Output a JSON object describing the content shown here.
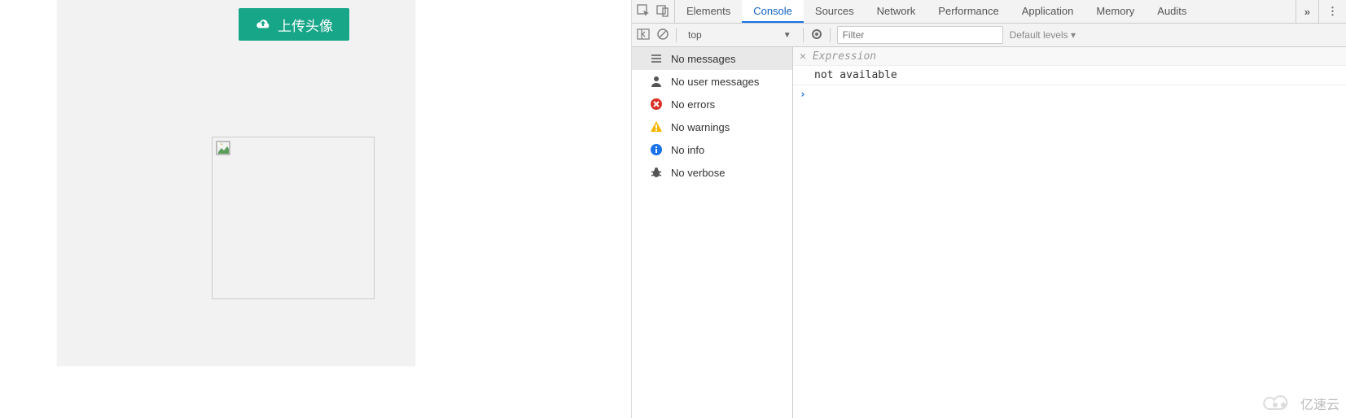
{
  "left": {
    "upload_label": "上传头像"
  },
  "devtools": {
    "tabs": [
      "Elements",
      "Console",
      "Sources",
      "Network",
      "Performance",
      "Application",
      "Memory",
      "Audits"
    ],
    "active_tab": "Console",
    "more": "»",
    "toolbar": {
      "context": "top",
      "filter_placeholder": "Filter",
      "levels": "Default levels ▾"
    },
    "sidebar": {
      "items": [
        {
          "icon": "list",
          "label": "No messages"
        },
        {
          "icon": "user",
          "label": "No user messages"
        },
        {
          "icon": "error",
          "label": "No errors"
        },
        {
          "icon": "warn",
          "label": "No warnings"
        },
        {
          "icon": "info",
          "label": "No info"
        },
        {
          "icon": "bug",
          "label": "No verbose"
        }
      ],
      "active_index": 0
    },
    "output": {
      "expression_placeholder": "Expression",
      "result": "not available"
    }
  },
  "watermark": "亿速云"
}
